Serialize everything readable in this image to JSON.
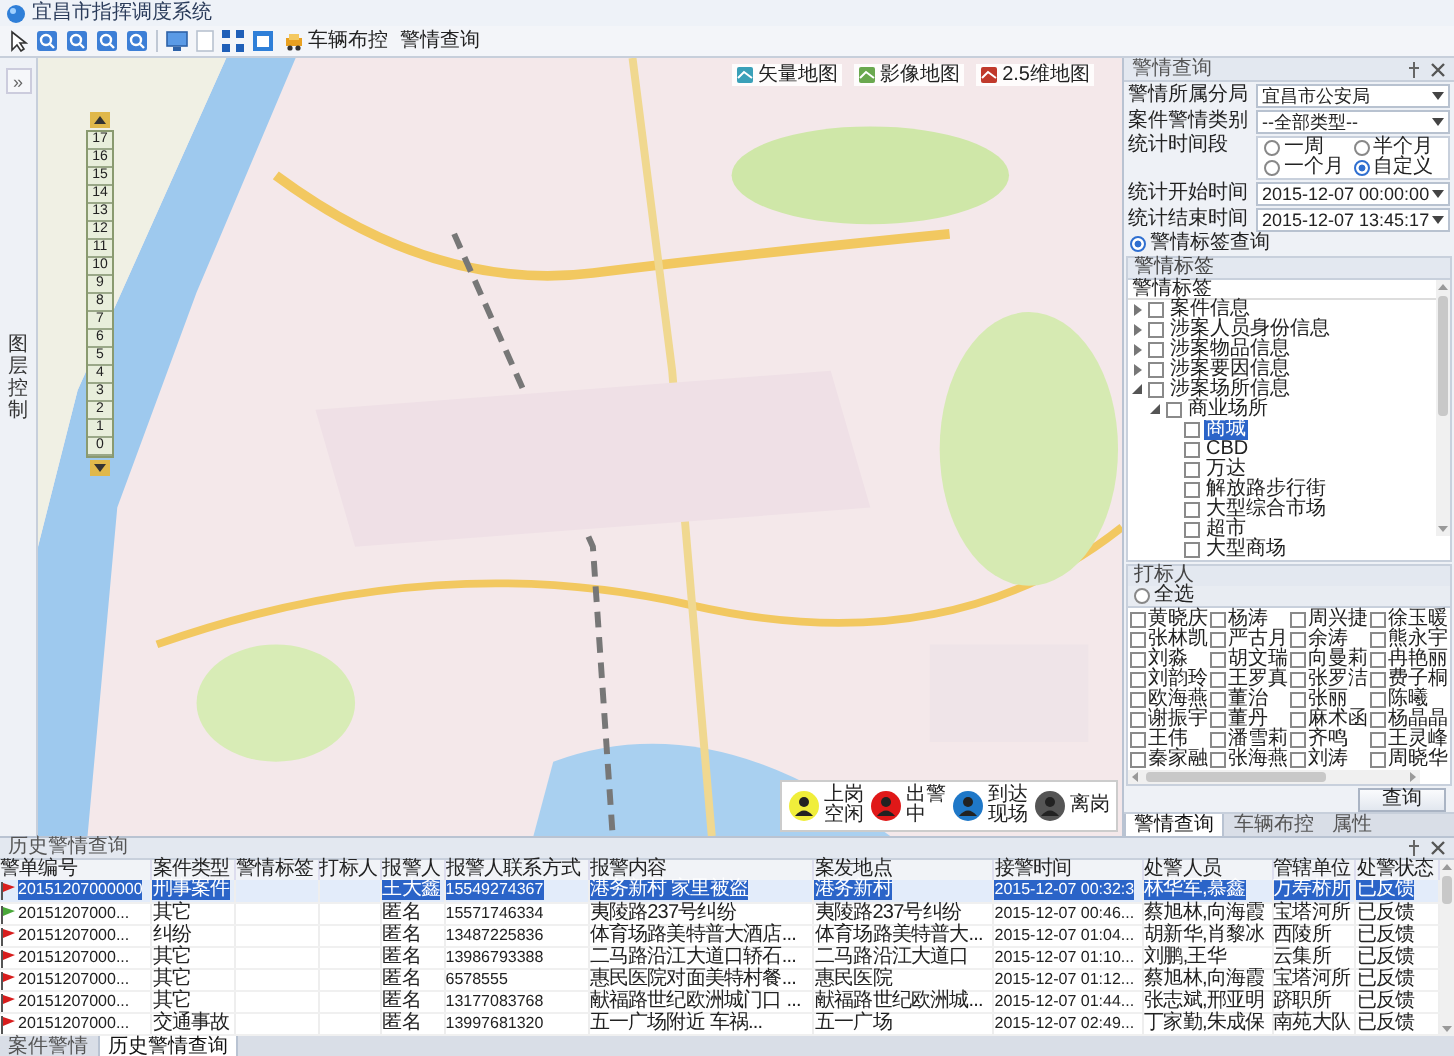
{
  "window": {
    "title": "宜昌市指挥调度系统"
  },
  "toolbar": {
    "buttons": [
      {
        "label": "车辆布控"
      },
      {
        "label": "警情查询"
      }
    ]
  },
  "left_strip": {
    "expand": "»",
    "label": "图层控制"
  },
  "map": {
    "layers": [
      {
        "label": "矢量地图"
      },
      {
        "label": "影像地图"
      },
      {
        "label": "2.5维地图"
      }
    ],
    "zoom_levels": [
      "17",
      "16",
      "15",
      "14",
      "13",
      "12",
      "11",
      "10",
      "9",
      "8",
      "7",
      "6",
      "5",
      "4",
      "3",
      "2",
      "1",
      "0"
    ],
    "legend": [
      {
        "label": "上岗空闲",
        "color": "#f0ee3a"
      },
      {
        "label": "出警中",
        "color": "#e01818"
      },
      {
        "label": "到达现场",
        "color": "#1f78c8"
      },
      {
        "label": "离岗",
        "color": "#555555"
      }
    ]
  },
  "right_panel": {
    "title": "警情查询",
    "fields": [
      {
        "label": "警情所属分局",
        "value": "宜昌市公安局"
      },
      {
        "label": "案件警情类别",
        "value": "--全部类型--"
      }
    ],
    "period": {
      "label": "统计时间段",
      "options": [
        {
          "label": "一周",
          "selected": false
        },
        {
          "label": "半个月",
          "selected": false
        },
        {
          "label": "一个月",
          "selected": false
        },
        {
          "label": "自定义",
          "selected": true
        }
      ]
    },
    "times": [
      {
        "label": "统计开始时间",
        "value": "2015-12-07 00:00:00"
      },
      {
        "label": "统计结束时间",
        "value": "2015-12-07 13:45:17"
      }
    ],
    "tag_query": {
      "label": "警情标签查询",
      "selected": true
    },
    "tag_group": {
      "title": "警情标签",
      "header": "警情标签",
      "tree": [
        {
          "label": "案件信息",
          "checked": false,
          "expanded": false,
          "selected": false
        },
        {
          "label": "涉案人员身份信息",
          "checked": false,
          "expanded": false,
          "selected": false
        },
        {
          "label": "涉案物品信息",
          "checked": false,
          "expanded": false,
          "selected": false
        },
        {
          "label": "涉案要因信息",
          "checked": false,
          "expanded": false,
          "selected": false
        },
        {
          "label": "涉案场所信息",
          "checked": false,
          "expanded": true,
          "selected": false,
          "children": [
            {
              "label": "商业场所",
              "checked": false,
              "expanded": true,
              "selected": false,
              "children": [
                {
                  "label": "商城",
                  "checked": false,
                  "selected": true
                },
                {
                  "label": "CBD",
                  "checked": false,
                  "selected": false
                },
                {
                  "label": "万达",
                  "checked": false,
                  "selected": false
                },
                {
                  "label": "解放路步行街",
                  "checked": false,
                  "selected": false
                },
                {
                  "label": "大型综合市场",
                  "checked": false,
                  "selected": false
                },
                {
                  "label": "超市",
                  "checked": false,
                  "selected": false
                },
                {
                  "label": "大型商场",
                  "checked": false,
                  "selected": false
                }
              ]
            }
          ]
        }
      ]
    },
    "markers_group": {
      "title": "打标人",
      "select_all": {
        "label": "全选",
        "selected": false
      },
      "people": [
        {
          "label": "黄晓庆",
          "checked": false
        },
        {
          "label": "杨涛",
          "checked": false
        },
        {
          "label": "周兴捷",
          "checked": false
        },
        {
          "label": "徐玉暖",
          "checked": false
        },
        {
          "label": "张林凯",
          "checked": false
        },
        {
          "label": "严古月",
          "checked": false
        },
        {
          "label": "余涛",
          "checked": false
        },
        {
          "label": "熊永宇",
          "checked": false
        },
        {
          "label": "刘淼",
          "checked": false
        },
        {
          "label": "胡文瑞",
          "checked": false
        },
        {
          "label": "向曼莉",
          "checked": false
        },
        {
          "label": "冉艳丽",
          "checked": false
        },
        {
          "label": "刘韵玲",
          "checked": false
        },
        {
          "label": "王罗真",
          "checked": false
        },
        {
          "label": "张罗洁",
          "checked": false
        },
        {
          "label": "费子桐",
          "checked": false
        },
        {
          "label": "欧海燕",
          "checked": false
        },
        {
          "label": "董治",
          "checked": false
        },
        {
          "label": "张丽",
          "checked": false
        },
        {
          "label": "陈曦",
          "checked": false
        },
        {
          "label": "谢振宇",
          "checked": false
        },
        {
          "label": "董丹",
          "checked": false
        },
        {
          "label": "麻术函",
          "checked": false
        },
        {
          "label": "杨晶晶",
          "checked": false
        },
        {
          "label": "王伟",
          "checked": false
        },
        {
          "label": "潘雪莉",
          "checked": false
        },
        {
          "label": "齐鸣",
          "checked": false
        },
        {
          "label": "王灵峰",
          "checked": false
        },
        {
          "label": "秦家融",
          "checked": false
        },
        {
          "label": "张海燕",
          "checked": false
        },
        {
          "label": "刘涛",
          "checked": false
        },
        {
          "label": "周晓华",
          "checked": false
        }
      ]
    },
    "query_button": "查询",
    "tabs": [
      {
        "label": "警情查询",
        "selected": true
      },
      {
        "label": "车辆布控",
        "selected": false
      },
      {
        "label": "属性",
        "selected": false
      }
    ]
  },
  "history_panel": {
    "title": "历史警情查询",
    "columns": [
      "警单编号",
      "案件类型",
      "警情标签",
      "打标人",
      "报警人",
      "报警人联系方式",
      "报警内容",
      "案发地点",
      "接警时间",
      "处警人员",
      "管辖单位",
      "处警状态"
    ],
    "rows": [
      {
        "color": "#d81e1e",
        "selected": true,
        "cells": [
          "20151207000000",
          "刑事案件",
          "",
          "",
          "王大鑫",
          "15549274367",
          "港务新村 家里被盗",
          "港务新村",
          "2015-12-07 00:32:3",
          "林华军,慕鑫",
          "万寿桥所",
          "已反馈"
        ]
      },
      {
        "color": "#4aa83a",
        "selected": false,
        "cells": [
          "20151207000...",
          "其它",
          "",
          "",
          "匿名",
          "15571746334",
          "夷陵路237号纠纷",
          "夷陵路237号纠纷",
          "2015-12-07 00:46...",
          "蔡旭林,向海霞",
          "宝塔河所",
          "已反馈"
        ]
      },
      {
        "color": "#d81e1e",
        "selected": false,
        "cells": [
          "20151207000...",
          "纠纷",
          "",
          "",
          "匿名",
          "13487225836",
          "体育场路美特普大酒店...",
          "体育场路美特普大...",
          "2015-12-07 01:04...",
          "胡新华,肖黎冰",
          "西陵所",
          "已反馈"
        ]
      },
      {
        "color": "#d81e1e",
        "selected": false,
        "cells": [
          "20151207000...",
          "其它",
          "",
          "",
          "匿名",
          "13986793388",
          "二马路沿江大道口轿石...",
          "二马路沿江大道口",
          "2015-12-07 01:10...",
          "刘鹏,王华",
          "云集所",
          "已反馈"
        ]
      },
      {
        "color": "#d81e1e",
        "selected": false,
        "cells": [
          "20151207000...",
          "其它",
          "",
          "",
          "匿名",
          "6578555",
          "惠民医院对面美特村餐...",
          "惠民医院",
          "2015-12-07 01:12...",
          "蔡旭林,向海霞",
          "宝塔河所",
          "已反馈"
        ]
      },
      {
        "color": "#d81e1e",
        "selected": false,
        "cells": [
          "20151207000...",
          "其它",
          "",
          "",
          "匿名",
          "13177083768",
          "献福路世纪欧洲城门口 ...",
          "献福路世纪欧洲城...",
          "2015-12-07 01:44...",
          "张志斌,邢亚明",
          "跻职所",
          "已反馈"
        ]
      },
      {
        "color": "#d81e1e",
        "selected": false,
        "cells": [
          "20151207000...",
          "交通事故",
          "",
          "",
          "匿名",
          "13997681320",
          "五一广场附近 车祸...",
          "五一广场",
          "2015-12-07 02:49...",
          "丁家勤,朱成保",
          "南苑大队",
          "已反馈"
        ]
      }
    ],
    "tabs": [
      {
        "label": "案件警情",
        "selected": false
      },
      {
        "label": "历史警情查询",
        "selected": true
      }
    ]
  }
}
